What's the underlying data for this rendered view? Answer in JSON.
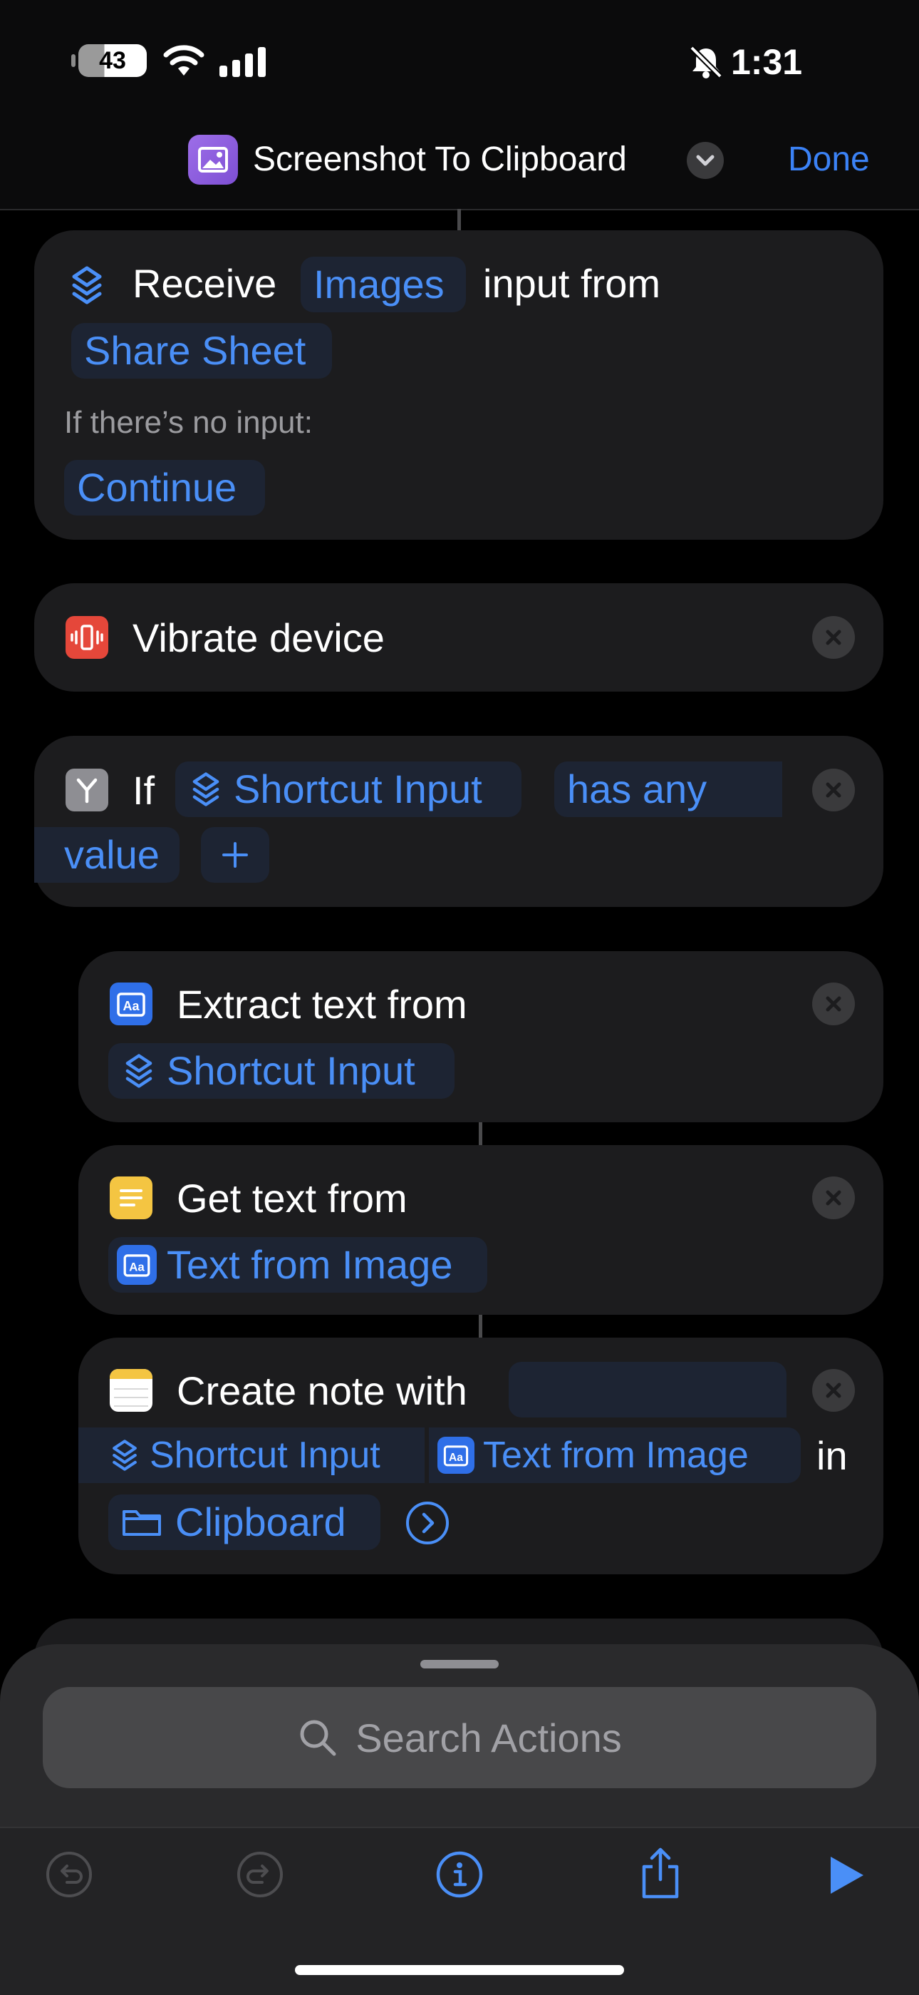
{
  "status_bar": {
    "battery": "43",
    "time": "1:31"
  },
  "nav": {
    "title": "Screenshot To Clipboard",
    "done": "Done"
  },
  "receive": {
    "verb": "Receive",
    "type": "Images",
    "from": "input from",
    "source": "Share Sheet",
    "no_input_label": "If there’s no input:",
    "no_input_action": "Continue"
  },
  "vibrate": {
    "label": "Vibrate device"
  },
  "if_block": {
    "if": "If",
    "variable": "Shortcut Input",
    "condition_1": "has any",
    "condition_2": "value",
    "add": "+"
  },
  "extract": {
    "label": "Extract text from",
    "input": "Shortcut Input"
  },
  "get_text": {
    "label": "Get text from",
    "input": "Text from Image"
  },
  "create_note": {
    "label": "Create note with",
    "input_1": "Shortcut Input",
    "input_2": "Text from Image",
    "in": "in",
    "folder": "Clipboard"
  },
  "search": {
    "placeholder": "Search Actions"
  },
  "colors": {
    "accent": "#3b82f6",
    "card": "#1c1c1e",
    "chip": "#1d2433"
  }
}
